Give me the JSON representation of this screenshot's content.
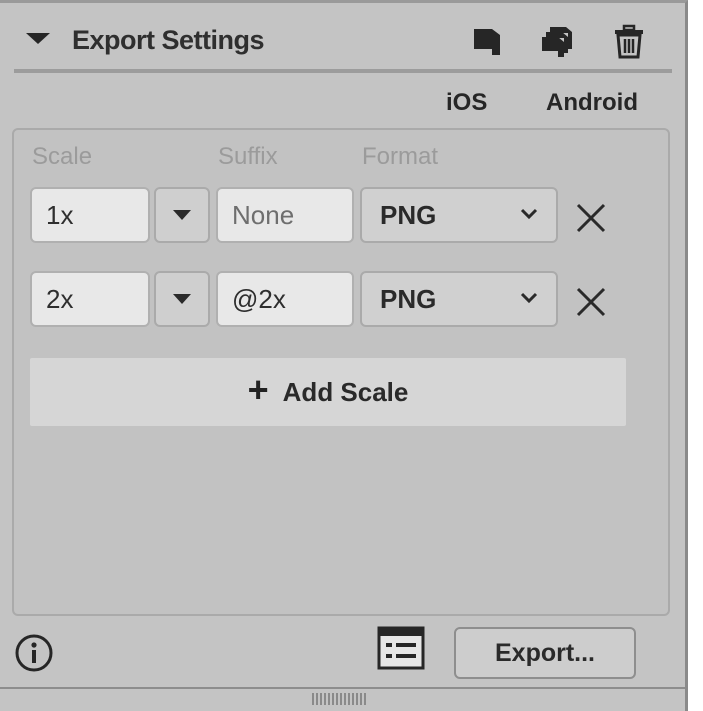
{
  "header": {
    "title": "Export Settings",
    "icons": [
      "export-single-icon",
      "export-multiple-icon",
      "trash-icon"
    ]
  },
  "platforms": {
    "ios": "iOS",
    "android": "Android"
  },
  "columns": {
    "scale": "Scale",
    "suffix": "Suffix",
    "format": "Format"
  },
  "rows": [
    {
      "scale": "1x",
      "suffix": "None",
      "format": "PNG"
    },
    {
      "scale": "2x",
      "suffix": "@2x",
      "format": "PNG"
    }
  ],
  "add_scale": {
    "plus": "+",
    "label": "Add Scale"
  },
  "footer": {
    "export_label": "Export..."
  },
  "colors": {
    "panel_bg": "#c4c4c4",
    "field_bg": "#e8e8e8",
    "text": "#2b2b2b",
    "muted_header": "#9b9b9b"
  }
}
